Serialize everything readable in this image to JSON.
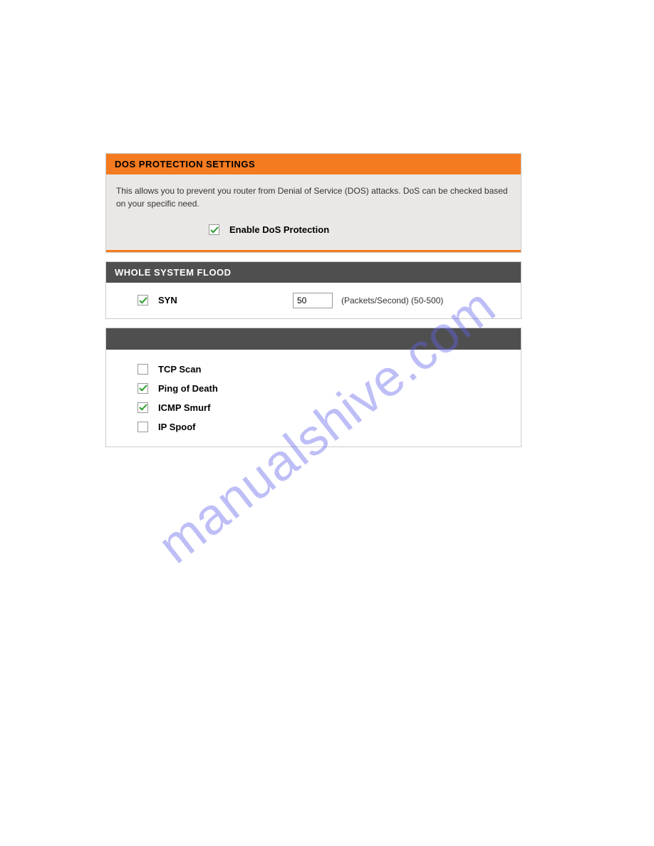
{
  "watermark": "manualshive.com",
  "dos_panel": {
    "header": "DOS PROTECTION SETTINGS",
    "description": "This allows you to prevent you router from Denial of Service (DOS) attacks. DoS can be checked based on your specific need.",
    "enable_label": "Enable DoS Protection",
    "enable_checked": true
  },
  "flood_panel": {
    "header": "WHOLE SYSTEM FLOOD",
    "syn": {
      "label": "SYN",
      "checked": true,
      "value": "50",
      "hint": "(Packets/Second) (50-500)"
    }
  },
  "attacks_panel": {
    "options": [
      {
        "label": "TCP Scan",
        "checked": false
      },
      {
        "label": "Ping of Death",
        "checked": true
      },
      {
        "label": "ICMP Smurf",
        "checked": true
      },
      {
        "label": "IP Spoof",
        "checked": false
      }
    ]
  }
}
